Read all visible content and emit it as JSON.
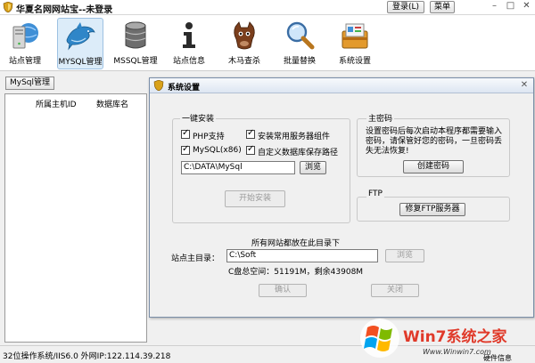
{
  "app": {
    "title": "华夏名网网站宝--未登录",
    "login_label": "登录(L)",
    "menu_label": "菜单"
  },
  "toolbar": [
    {
      "label": "站点管理",
      "icon": "server-icon"
    },
    {
      "label": "MYSQL管理",
      "icon": "dolphin-icon"
    },
    {
      "label": "MSSQL管理",
      "icon": "database-icon"
    },
    {
      "label": "站点信息",
      "icon": "info-icon"
    },
    {
      "label": "木马查杀",
      "icon": "trojan-horse-icon"
    },
    {
      "label": "批量替换",
      "icon": "magnifier-icon"
    },
    {
      "label": "系统设置",
      "icon": "settings-icon"
    }
  ],
  "left": {
    "tab_label": "MySql管理",
    "col_host": "所属主机ID",
    "col_db": "数据库名"
  },
  "dialog": {
    "title": "系统设置",
    "install": {
      "group_label": "一键安装",
      "options": [
        "PHP支持",
        "安装常用服务器组件",
        "MySQL(x86)",
        "自定义数据库保存路径"
      ],
      "path_value": "C:\\DATA\\MySql",
      "browse_label": "浏览",
      "start_label": "开始安装"
    },
    "master": {
      "group_label": "主密码",
      "description": "设置密码后每次启动本程序都需要输入密码，请保管好您的密码，一旦密码丢失无法恢复!",
      "create_label": "创建密码"
    },
    "ftp": {
      "group_label": "FTP",
      "repair_label": "修复FTP服务器"
    },
    "site": {
      "hint": "所有网站都放在此目录下",
      "label": "站点主目录：",
      "value": "C:\\Soft",
      "browse_label": "浏览",
      "disk_info": "C盘总空间：51191M，剩余43908M"
    },
    "ok_label": "确认",
    "close_label": "关闭"
  },
  "status": {
    "text": "32位操作系统/IIS6.0 外网IP:122.114.39.218"
  },
  "watermark": {
    "brand": "Win7系统之家",
    "url": "Www.Winwin7.com",
    "overlay": "硬件信息"
  },
  "colors": {
    "accent": "#0b62b5",
    "watermark_red": "#e03a2a"
  }
}
